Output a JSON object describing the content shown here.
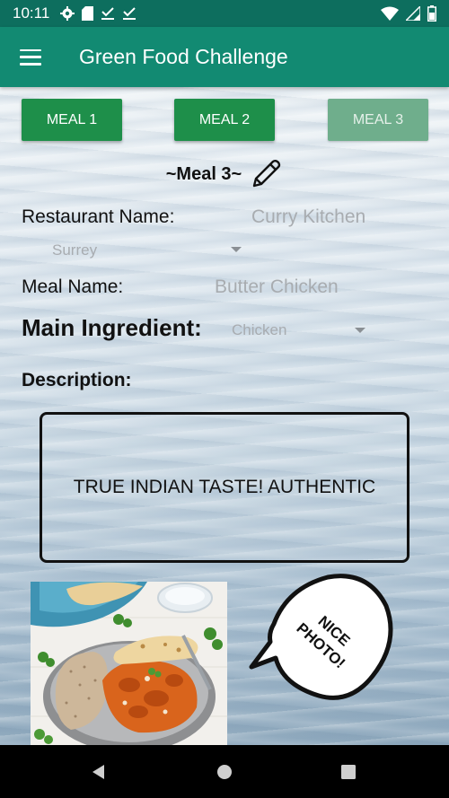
{
  "status_bar": {
    "time": "10:11",
    "icons": [
      "gear-icon",
      "sd-card-icon",
      "download-done-icon",
      "download-done-icon"
    ],
    "right_icons": [
      "wifi-icon",
      "signal-icon",
      "battery-icon"
    ]
  },
  "app_bar": {
    "title": "Green Food Challenge",
    "menu_icon": "hamburger-menu-icon"
  },
  "meal_tabs": [
    {
      "label": "MEAL 1",
      "enabled": true
    },
    {
      "label": "MEAL 2",
      "enabled": true
    },
    {
      "label": "MEAL 3",
      "enabled": false
    }
  ],
  "heading": {
    "text": "~Meal 3~",
    "edit_icon": "pencil-icon"
  },
  "form": {
    "restaurant_label": "Restaurant Name:",
    "restaurant_value": "Curry Kitchen",
    "location_value": "Surrey",
    "meal_label": "Meal Name:",
    "meal_value": "Butter Chicken",
    "ingredient_label": "Main Ingredient:",
    "ingredient_value": "Chicken",
    "description_label": "Description:",
    "description_value": "TRUE INDIAN TASTE! AUTHENTIC"
  },
  "photo": {
    "bubble_text_line1": "NICE",
    "bubble_text_line2": "PHOTO!"
  },
  "nav_bar": {
    "buttons": [
      "back-icon",
      "home-icon",
      "recents-icon"
    ]
  },
  "colors": {
    "status_bar": "#0d6e5e",
    "app_bar": "#128a72",
    "button": "#1e8f4a",
    "button_disabled": "#6fae8c"
  }
}
